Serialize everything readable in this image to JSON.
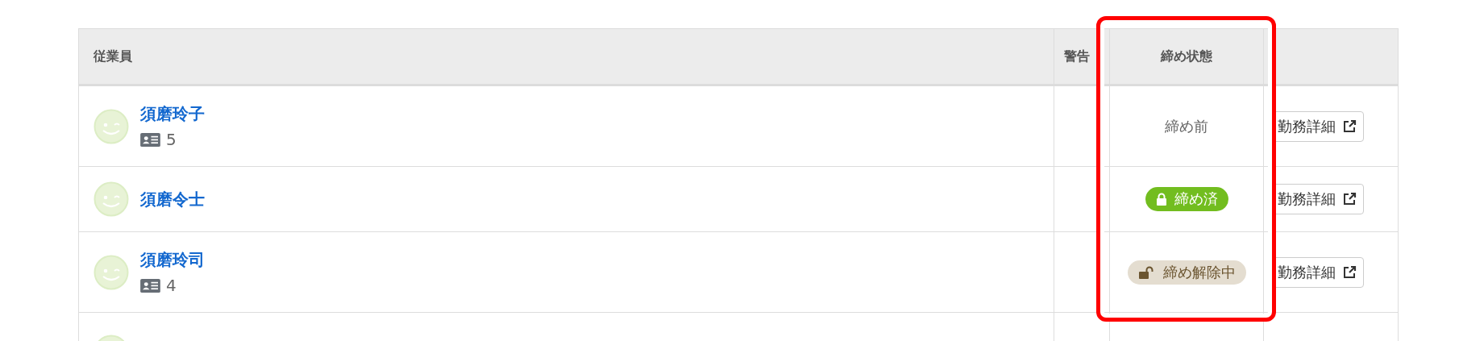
{
  "table": {
    "columns": [
      "従業員",
      "警告",
      "締め状態",
      ""
    ],
    "rows": [
      {
        "name": "須磨玲子",
        "id_count": "5",
        "status": {
          "kind": "before",
          "label": "締め前"
        },
        "action": "勤務詳細"
      },
      {
        "name": "須磨令士",
        "status": {
          "kind": "closed",
          "label": "締め済"
        },
        "action": "勤務詳細"
      },
      {
        "name": "須磨玲司",
        "id_count": "4",
        "status": {
          "kind": "unlocked",
          "label": "締め解除中"
        },
        "action": "勤務詳細"
      }
    ]
  }
}
